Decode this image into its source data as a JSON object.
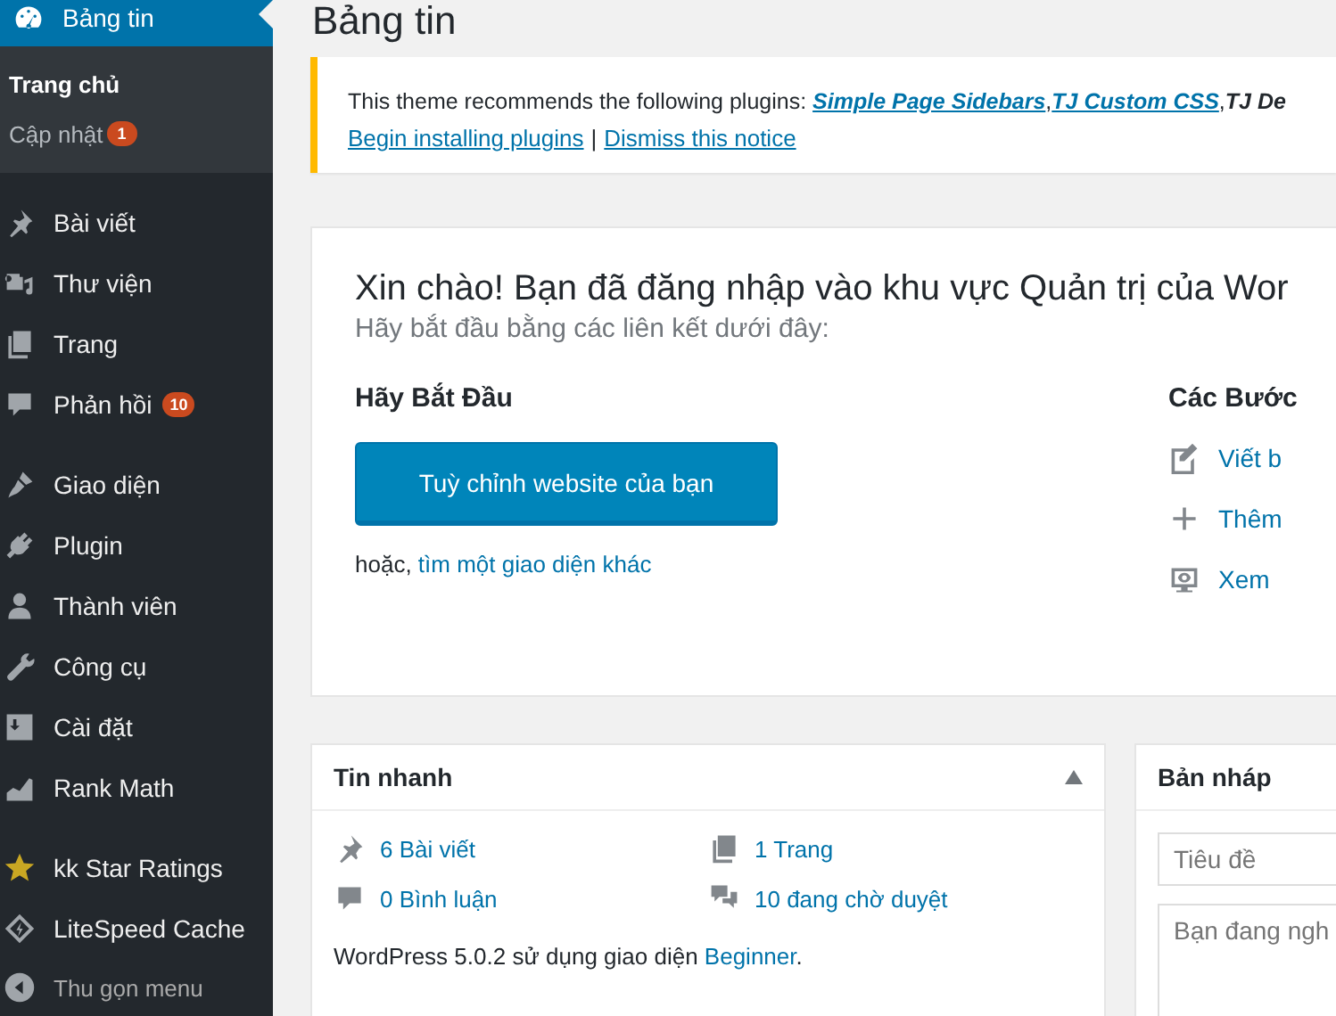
{
  "sidebar": {
    "current": {
      "label": "Bảng tin",
      "selected": true
    },
    "submenu": [
      {
        "label": "Trang chủ",
        "selected": true
      },
      {
        "label": "Cập nhật",
        "selected": false,
        "badge": "1"
      }
    ],
    "groups": [
      {
        "items": [
          {
            "label": "Bài viết"
          },
          {
            "label": "Thư viện"
          },
          {
            "label": "Trang"
          },
          {
            "label": "Phản hồi",
            "badge": "10"
          }
        ]
      },
      {
        "items": [
          {
            "label": "Giao diện"
          },
          {
            "label": "Plugin"
          },
          {
            "label": "Thành viên"
          },
          {
            "label": "Công cụ"
          },
          {
            "label": "Cài đặt"
          },
          {
            "label": "Rank Math"
          }
        ]
      },
      {
        "items": [
          {
            "label": "kk Star Ratings"
          },
          {
            "label": "LiteSpeed Cache"
          }
        ]
      }
    ],
    "collapse": "Thu gọn menu"
  },
  "page_title": "Bảng tin",
  "notice": {
    "text": "This theme recommends the following plugins:",
    "plugins": [
      {
        "name": "Simple Page Sidebars",
        "linked": true
      },
      {
        "name": "TJ Custom CSS",
        "linked": true
      },
      {
        "name": "TJ De",
        "linked": false
      }
    ],
    "list_separator": ",",
    "actions": [
      "Begin installing plugins",
      "Dismiss this notice"
    ],
    "separator": "|"
  },
  "welcome": {
    "title": "Xin chào! Bạn đã đăng nhập vào khu vực Quản trị của Wor",
    "subtitle": "Hãy bắt đầu bằng các liên kết dưới đây:",
    "get_started": {
      "heading": "Hãy Bắt Đầu",
      "button": "Tuỳ chỉnh website của bạn",
      "alt_prefix": "hoặc,",
      "alt_link": "tìm một giao diện khác"
    },
    "next_steps": {
      "heading": "Các Bước",
      "links": [
        "Viết b",
        "Thêm",
        "Xem"
      ]
    }
  },
  "at_a_glance": {
    "title": "Tin nhanh",
    "expanded": true,
    "stats": [
      {
        "label": "6 Bài viết"
      },
      {
        "label": "1 Trang"
      },
      {
        "label": "0 Bình luận"
      },
      {
        "label": "10 đang chờ duyệt"
      }
    ],
    "footer_text": "WordPress 5.0.2 sử dụng giao diện",
    "footer_link": "Beginner",
    "footer_end": "."
  },
  "quick_draft": {
    "title": "Bản nháp",
    "title_placeholder": "Tiêu đề",
    "content_placeholder": "Bạn đang ngh"
  }
}
